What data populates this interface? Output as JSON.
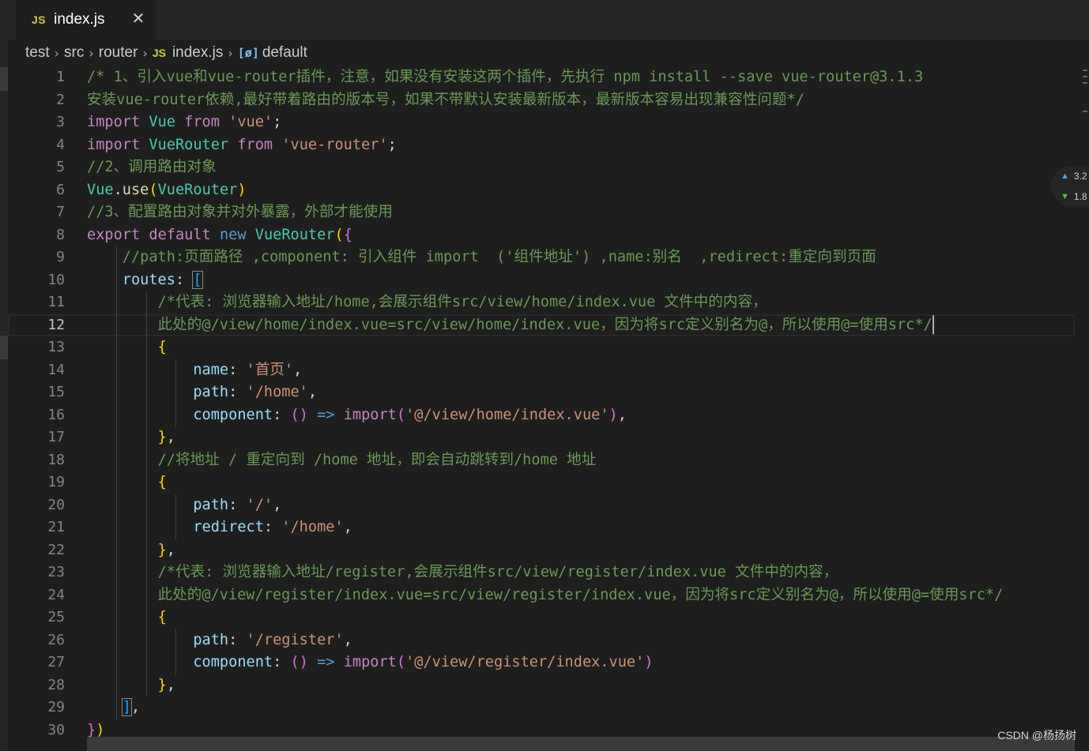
{
  "tab": {
    "icon_label": "JS",
    "filename": "index.js",
    "close_glyph": "✕"
  },
  "breadcrumb": {
    "items": [
      "test",
      "src",
      "router"
    ],
    "file_icon_label": "JS",
    "file": "index.js",
    "symbol_icon_label": "[ø]",
    "symbol": "default"
  },
  "stats": {
    "up": "3.2",
    "down": "1.8"
  },
  "watermark": "CSDN @杨扬树",
  "editor": {
    "current_line": 12,
    "lines": [
      {
        "n": "1",
        "text": "/* 1、引入vue和vue-router插件，注意，如果没有安装这两个插件，先执行 npm install --save vue-router@3.1.3"
      },
      {
        "n": "2",
        "text": "安装vue-router依赖,最好带着路由的版本号，如果不带默认安装最新版本，最新版本容易出现兼容性问题*/"
      },
      {
        "n": "3",
        "text": "import Vue from 'vue';"
      },
      {
        "n": "4",
        "text": "import VueRouter from 'vue-router';"
      },
      {
        "n": "5",
        "text": "//2、调用路由对象"
      },
      {
        "n": "6",
        "text": "Vue.use(VueRouter)"
      },
      {
        "n": "7",
        "text": "//3、配置路由对象并对外暴露，外部才能使用"
      },
      {
        "n": "8",
        "text": "export default new VueRouter({"
      },
      {
        "n": "9",
        "text": "    //path:页面路径 ,component: 引入组件 import  ('组件地址') ,name:别名  ,redirect:重定向到页面"
      },
      {
        "n": "10",
        "text": "    routes: ["
      },
      {
        "n": "11",
        "text": "        /*代表: 浏览器输入地址/home,会展示组件src/view/home/index.vue 文件中的内容，"
      },
      {
        "n": "12",
        "text": "        此处的@/view/home/index.vue=src/view/home/index.vue，因为将src定义别名为@，所以使用@=使用src*/"
      },
      {
        "n": "13",
        "text": "        {"
      },
      {
        "n": "14",
        "text": "            name: '首页',"
      },
      {
        "n": "15",
        "text": "            path: '/home',"
      },
      {
        "n": "16",
        "text": "            component: () => import('@/view/home/index.vue'),"
      },
      {
        "n": "17",
        "text": "        },"
      },
      {
        "n": "18",
        "text": "        //将地址 / 重定向到 /home 地址，即会自动跳转到/home 地址"
      },
      {
        "n": "19",
        "text": "        {"
      },
      {
        "n": "20",
        "text": "            path: '/',"
      },
      {
        "n": "21",
        "text": "            redirect: '/home',"
      },
      {
        "n": "22",
        "text": "        },"
      },
      {
        "n": "23",
        "text": "        /*代表: 浏览器输入地址/register,会展示组件src/view/register/index.vue 文件中的内容，"
      },
      {
        "n": "24",
        "text": "        此处的@/view/register/index.vue=src/view/register/index.vue，因为将src定义别名为@，所以使用@=使用src*/"
      },
      {
        "n": "25",
        "text": "        {"
      },
      {
        "n": "26",
        "text": "            path: '/register',"
      },
      {
        "n": "27",
        "text": "            component: () => import('@/view/register/index.vue')"
      },
      {
        "n": "28",
        "text": "        },"
      },
      {
        "n": "29",
        "text": "    ],"
      },
      {
        "n": "30",
        "text": "})"
      }
    ]
  }
}
